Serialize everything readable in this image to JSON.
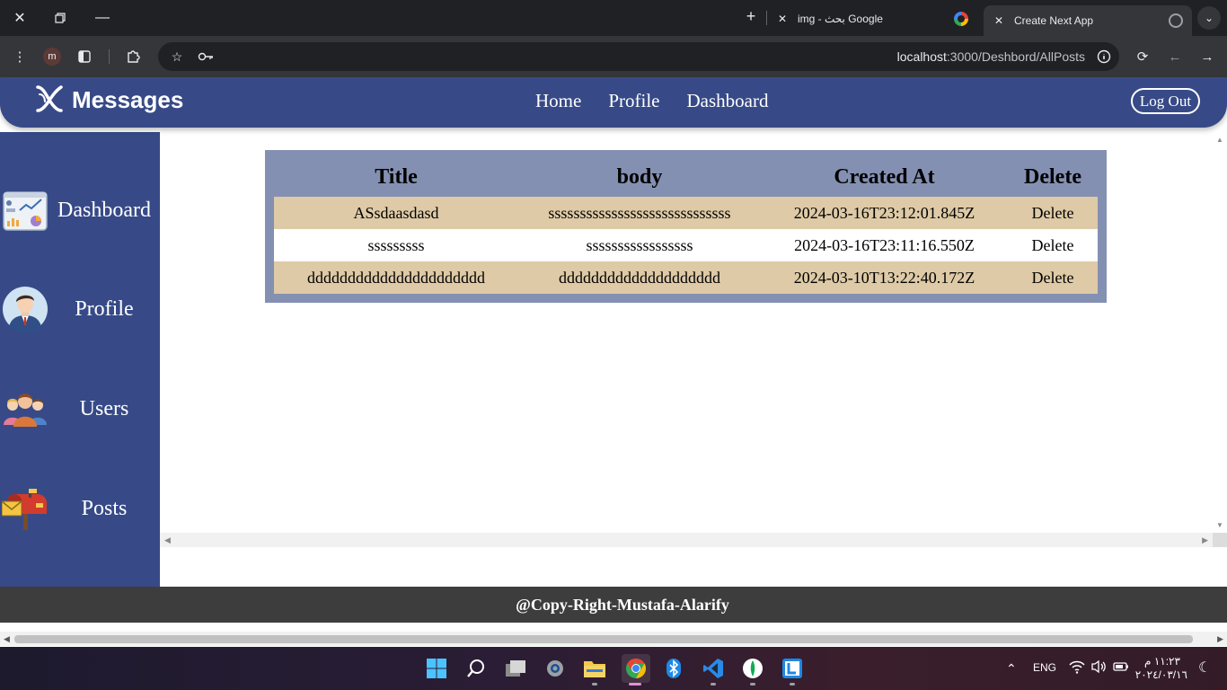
{
  "browser": {
    "tabs": [
      {
        "title": "img - بحث Google",
        "active": false
      },
      {
        "title": "Create Next App",
        "active": true
      }
    ],
    "profile_initial": "m",
    "url_host": "localhost",
    "url_path": ":3000/Deshbord/AllPosts"
  },
  "header": {
    "brand": "Messages",
    "nav": [
      "Home",
      "Profile",
      "Dashboard"
    ],
    "logout_label": "Log Out"
  },
  "sidebar": {
    "items": [
      {
        "label": "Dashboard",
        "icon": "dashboard-chart-icon"
      },
      {
        "label": "Profile",
        "icon": "person-avatar-icon"
      },
      {
        "label": "Users",
        "icon": "users-group-icon"
      },
      {
        "label": "Posts",
        "icon": "mailbox-icon"
      }
    ]
  },
  "table": {
    "headers": [
      "Title",
      "body",
      "Created At",
      "Delete"
    ],
    "rows": [
      {
        "title": "ASsdaasdasd",
        "body": "sssssssssssssssssssssssssssss",
        "created_at": "2024-03-16T23:12:01.845Z",
        "delete": "Delete"
      },
      {
        "title": "sssssssss",
        "body": "sssssssssssssssss",
        "created_at": "2024-03-16T23:11:16.550Z",
        "delete": "Delete"
      },
      {
        "title": "dddddddddddddddddddddd",
        "body": "dddddddddddddddddddd",
        "created_at": "2024-03-10T13:22:40.172Z",
        "delete": "Delete"
      }
    ]
  },
  "footer": {
    "text": "@Copy-Right-Mustafa-Alarify"
  },
  "taskbar": {
    "language": "ENG",
    "time": "١١:٢٣ م",
    "date": "٢٠٢٤/٠٣/١٦"
  },
  "colors": {
    "header_bg": "#374a87",
    "table_frame": "#8490b2",
    "row_odd": "#decaa6",
    "footer_bg": "#3d3d3d"
  }
}
